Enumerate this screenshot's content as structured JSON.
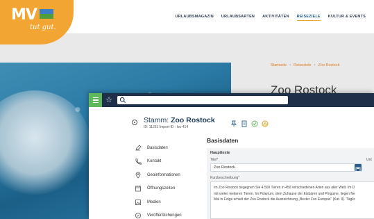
{
  "website": {
    "logo": {
      "brand": "MV",
      "tagline": "tut gut."
    },
    "nav": [
      "URLAUBSMAGAZIN",
      "URLAUBSARTEN",
      "AKTIVITÄTEN",
      "REISEZIELE",
      "KULTUR & EVENTS"
    ],
    "nav_active_index": 3,
    "breadcrumb": [
      "Startseite",
      "Reiseziele",
      "Zoo Rostock"
    ],
    "page_title": "Zoo Rostock",
    "colors": {
      "brand_orange": "#f3a533",
      "nav_text": "#2b3b4b",
      "link": "#e07b1b"
    }
  },
  "cms": {
    "search_placeholder": "",
    "entity": {
      "title_prefix": "Stamm:",
      "title_name": "Zoo Rostock",
      "ids": "ID: 11251   Import-ID : loc-414"
    },
    "sidebar": [
      {
        "label": "Basisdaten",
        "icon": "pencil-icon"
      },
      {
        "label": "Kontakt",
        "icon": "phone-icon"
      },
      {
        "label": "Geoinformationen",
        "icon": "map-pin-icon"
      },
      {
        "label": "Öffnungszeiten",
        "icon": "calendar-icon"
      },
      {
        "label": "Medien",
        "icon": "image-icon"
      },
      {
        "label": "Veröffentlichungen",
        "icon": "globe-icon"
      }
    ],
    "section_title": "Basisdaten",
    "panel": {
      "heading": "Haupttexte",
      "titel_label": "Titel*",
      "unter_label": "Unt",
      "titel_value": "Zoo Rostock",
      "kurz_label": "Kurzbeschreibung*",
      "kurz_lines": [
        "Im Zoo Rostock begegnen Sie 4.500 Tieren in 450 verschiedenen Arten aus aller Welt. Im D",
        "mit vielen weiteren Tieren. Im Polarium, dem Zuhause der Eisbären und Pinguine, liegen Ne",
        "Mal in Folge erhielt der Zoo Rostock die Auszeichnung „Bester Zoo Europas\" (Kat. II). Täglic"
      ]
    },
    "colors": {
      "topbar": "#1f2f4a",
      "menu_green": "#5fb95a",
      "title_blue": "#1f3b5a"
    }
  }
}
